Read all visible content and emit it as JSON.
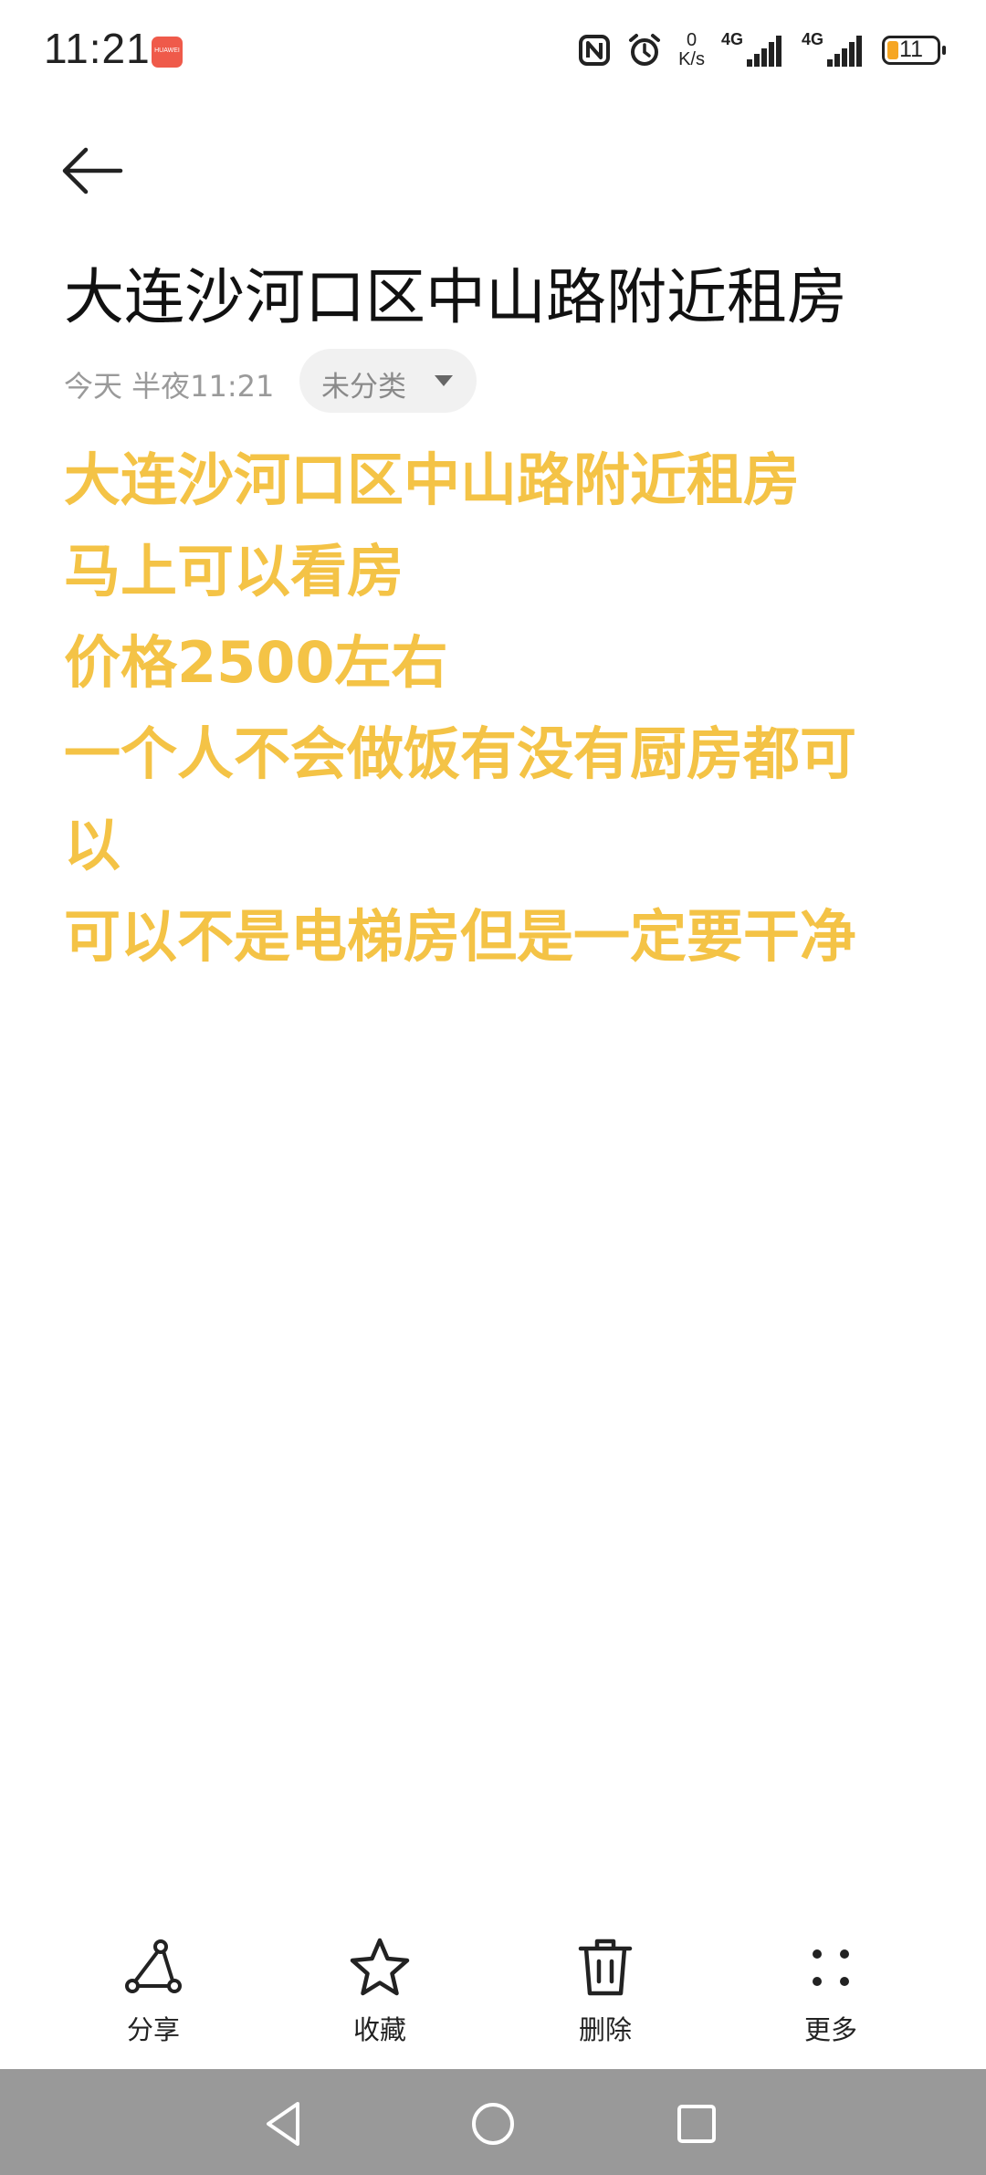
{
  "status_bar": {
    "time": "11:21",
    "app_badge": "HUAWEI",
    "net_speed_value": "0",
    "net_speed_unit": "K/s",
    "signal1_label": "4G",
    "signal2_label": "4G",
    "battery_level": "11",
    "battery_color": "#f6a623"
  },
  "header": {
    "back_icon": "arrow-left-icon"
  },
  "note": {
    "title": "大连沙河口区中山路附近租房",
    "meta_time": "今天 半夜11:21",
    "category": "未分类",
    "body_color": "#f4c346",
    "lines": [
      "大连沙河口区中山路附近租房",
      "马上可以看房",
      "价格2500左右",
      "一个人不会做饭有没有厨房都可",
      "以",
      "可以不是电梯房但是一定要干净"
    ]
  },
  "toolbar": {
    "share": "分享",
    "favorite": "收藏",
    "delete": "删除",
    "more": "更多"
  },
  "navbar": {
    "back": "triangle-back-icon",
    "home": "circle-home-icon",
    "recents": "square-recents-icon"
  }
}
